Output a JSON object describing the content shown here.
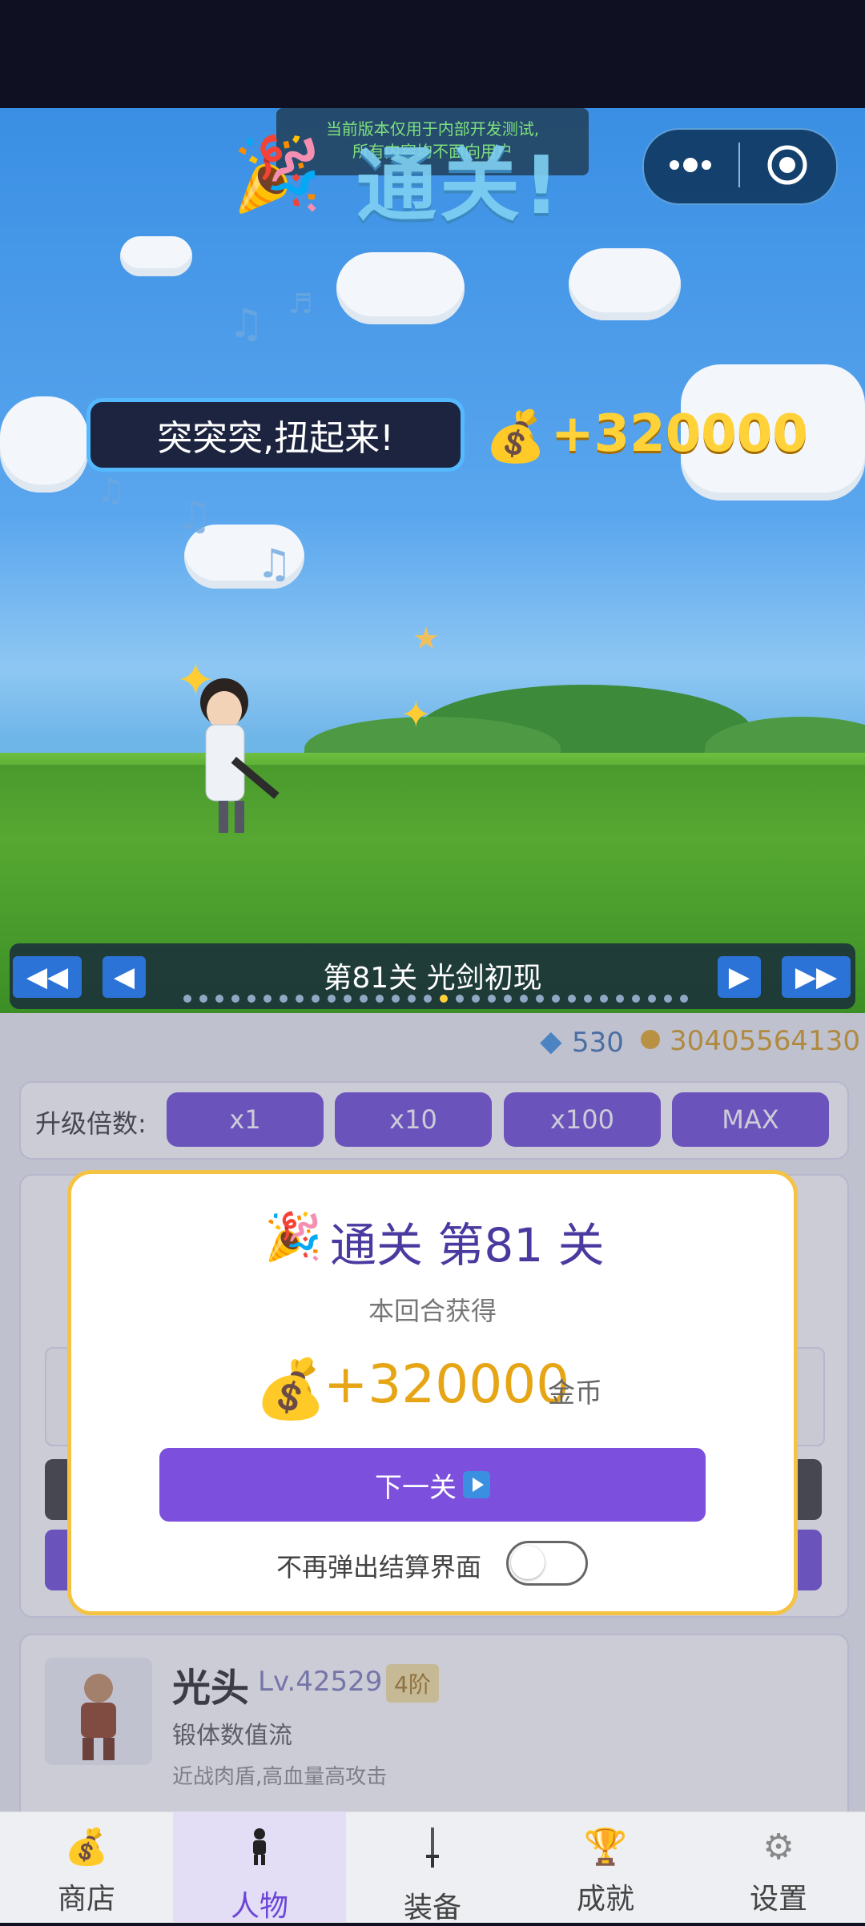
{
  "notice": {
    "line1": "当前版本仅用于内部开发测试,",
    "line2": "所有内容均不面向用户"
  },
  "scene": {
    "banner_title": "通关!",
    "speech": "突突突,扭起来!",
    "reward_amount": "+320000"
  },
  "level_nav": {
    "first": "◀◀",
    "prev": "◀",
    "label": "第81关  光剑初现",
    "next": "▶",
    "last": "▶▶"
  },
  "currency": {
    "gems": "530",
    "coins": "30405564130"
  },
  "multiplier": {
    "label": "升级倍数:",
    "options": [
      "x1",
      "x10",
      "x100",
      "MAX"
    ]
  },
  "modal": {
    "title": "通关 第81 关",
    "subtitle": "本回合获得",
    "amount": "+320000",
    "unit": "金币",
    "next_button": "下一关",
    "toggle_label": "不再弹出结算界面",
    "toggle_on": false
  },
  "hero": {
    "name": "光头",
    "level": "Lv.42529",
    "tier": "4阶",
    "school": "锻体数值流",
    "description": "近战肉盾,高血量高攻击"
  },
  "tabs": [
    {
      "label": "商店",
      "icon": "bag-icon"
    },
    {
      "label": "人物",
      "icon": "person-icon",
      "active": true
    },
    {
      "label": "装备",
      "icon": "sword-icon"
    },
    {
      "label": "成就",
      "icon": "trophy-icon"
    },
    {
      "label": "设置",
      "icon": "gear-icon"
    }
  ],
  "colors": {
    "accent": "#6b46d6",
    "gold": "#ffd23a",
    "modal_border": "#f5c344"
  }
}
